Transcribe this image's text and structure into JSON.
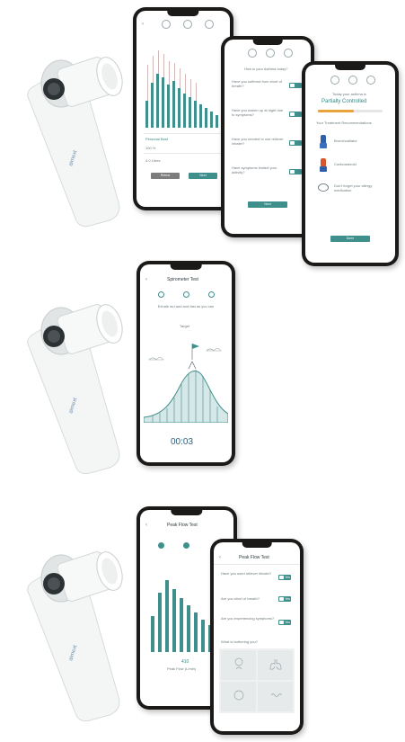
{
  "scene1": {
    "phone1": {
      "result_left": "Personal Best",
      "result_pct": "100 %",
      "result_val": "4.0 Litres",
      "btn_retry": "Retest",
      "btn_next": "Next"
    },
    "phone2": {
      "heading": "How is your Asthma today?",
      "questions": [
        "Have you suffered from short of breath?",
        "Have you woken up at night due to symptoms?",
        "Have you needed to use reliever inhaler?",
        "Have symptoms limited your activity?"
      ],
      "btn_next": "Next"
    },
    "phone3": {
      "status_label": "Today your asthma is",
      "status_value": "Partially Controlled",
      "status_progress": 0.55,
      "recommendations_heading": "Your Treatment Recommendations",
      "rec_1": "Bronchodilator",
      "rec_2": "Corticosteroid",
      "rec_3": "Don't forget your allergy medication",
      "btn_done": "Done"
    }
  },
  "scene2": {
    "phone": {
      "title": "Spirometer Test",
      "instruction": "Exhale as hard and fast as you can",
      "target_label": "Target",
      "timer": "00:03"
    }
  },
  "scene3": {
    "phone1": {
      "title": "Peak Flow Test",
      "value": "410",
      "value_label": "Peak Flow (L/min)"
    },
    "phone2": {
      "title": "Peak Flow Test",
      "questions": [
        "Have you used reliever inhaler?",
        "Are you short of breath?",
        "Are you experiencing symptoms?"
      ],
      "symptoms_heading": "What is bothering you?",
      "toggle_label": "Yes"
    }
  }
}
